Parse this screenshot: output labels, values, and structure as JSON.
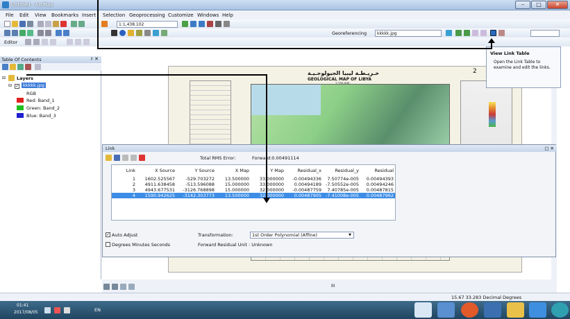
{
  "window": {
    "title": "Untitled - ArcMap",
    "min": "–",
    "max": "□",
    "close": "✕"
  },
  "menus": [
    "File",
    "Edit",
    "View",
    "Bookmarks",
    "Insert",
    "Selection",
    "Geoprocessing",
    "Customize",
    "Windows",
    "Help"
  ],
  "toolbar": {
    "scale_value": "1:1,438.102",
    "georef_label": "Georeferencing",
    "georef_layer": "kkkkk.jpg",
    "editor_label": "Editor"
  },
  "toc": {
    "title": "Table Of Contents",
    "pin": "♯ ✕",
    "layers_label": "Layers",
    "layer_name": "kkkkk.jpg",
    "rgb_label": "RGB",
    "bands": [
      {
        "label": "Red:  Band_1",
        "color": "#e02020"
      },
      {
        "label": "Green: Band_2",
        "color": "#20c020"
      },
      {
        "label": "Blue:  Band_3",
        "color": "#2020d0"
      }
    ]
  },
  "map": {
    "title_ar": "خـريـطـة ليبيا الجيولوجـيـة",
    "title_en": "GEOLOGICAL MAP OF LIBYA",
    "subtitle": "1:250,000",
    "sheet_number": "2"
  },
  "tooltip": {
    "title": "View Link Table",
    "body": "Open the Link Table to examine and edit the links."
  },
  "link_window": {
    "title": "Link",
    "total_rms_label": "Total RMS Error:",
    "total_rms_value": "Forward:0.00491114",
    "columns": [
      "Link",
      "X Source",
      "Y Source",
      "X Map",
      "Y Map",
      "Residual_x",
      "Residual_y",
      "Residual"
    ],
    "rows": [
      [
        "1",
        "1602.525567",
        "-529.703272",
        "13.500000",
        "33.000000",
        "-0.00494336",
        "7.50774e-005",
        "0.00494393"
      ],
      [
        "2",
        "4911.638458",
        "-513.596088",
        "15.000000",
        "33.000000",
        "0.00494189",
        "-7.50552e-005",
        "0.00494246"
      ],
      [
        "3",
        "4943.677531",
        "-3126.768898",
        "15.000000",
        "32.000000",
        "-0.00487759",
        "7.40785e-005",
        "0.00487815"
      ],
      [
        "4",
        "1590.942625",
        "-3142.303773",
        "13.500000",
        "32.000000",
        "0.00487905",
        "-7.41008e-005",
        "0.00487962"
      ]
    ],
    "selected_row": 3,
    "auto_adjust_label": "Auto Adjust",
    "auto_adjust_checked": "✓",
    "dms_label": "Degrees Minutes Seconds",
    "transformation_label": "Transformation:",
    "transformation_value": "1st Order Polynomial (Affine)",
    "residual_unit": "Forward Residual Unit : Unknown",
    "close": "□ ✕"
  },
  "status": {
    "coords": "15.67  33.283 Decimal Degrees",
    "scroll_mark": "III"
  },
  "taskbar": {
    "time": "01:41",
    "date": "2017/08/05",
    "lang": "EN"
  },
  "colors": {
    "selection": "#3d8de6",
    "taskbar": "#1f4560",
    "ribbon": "#dfe7f2"
  }
}
